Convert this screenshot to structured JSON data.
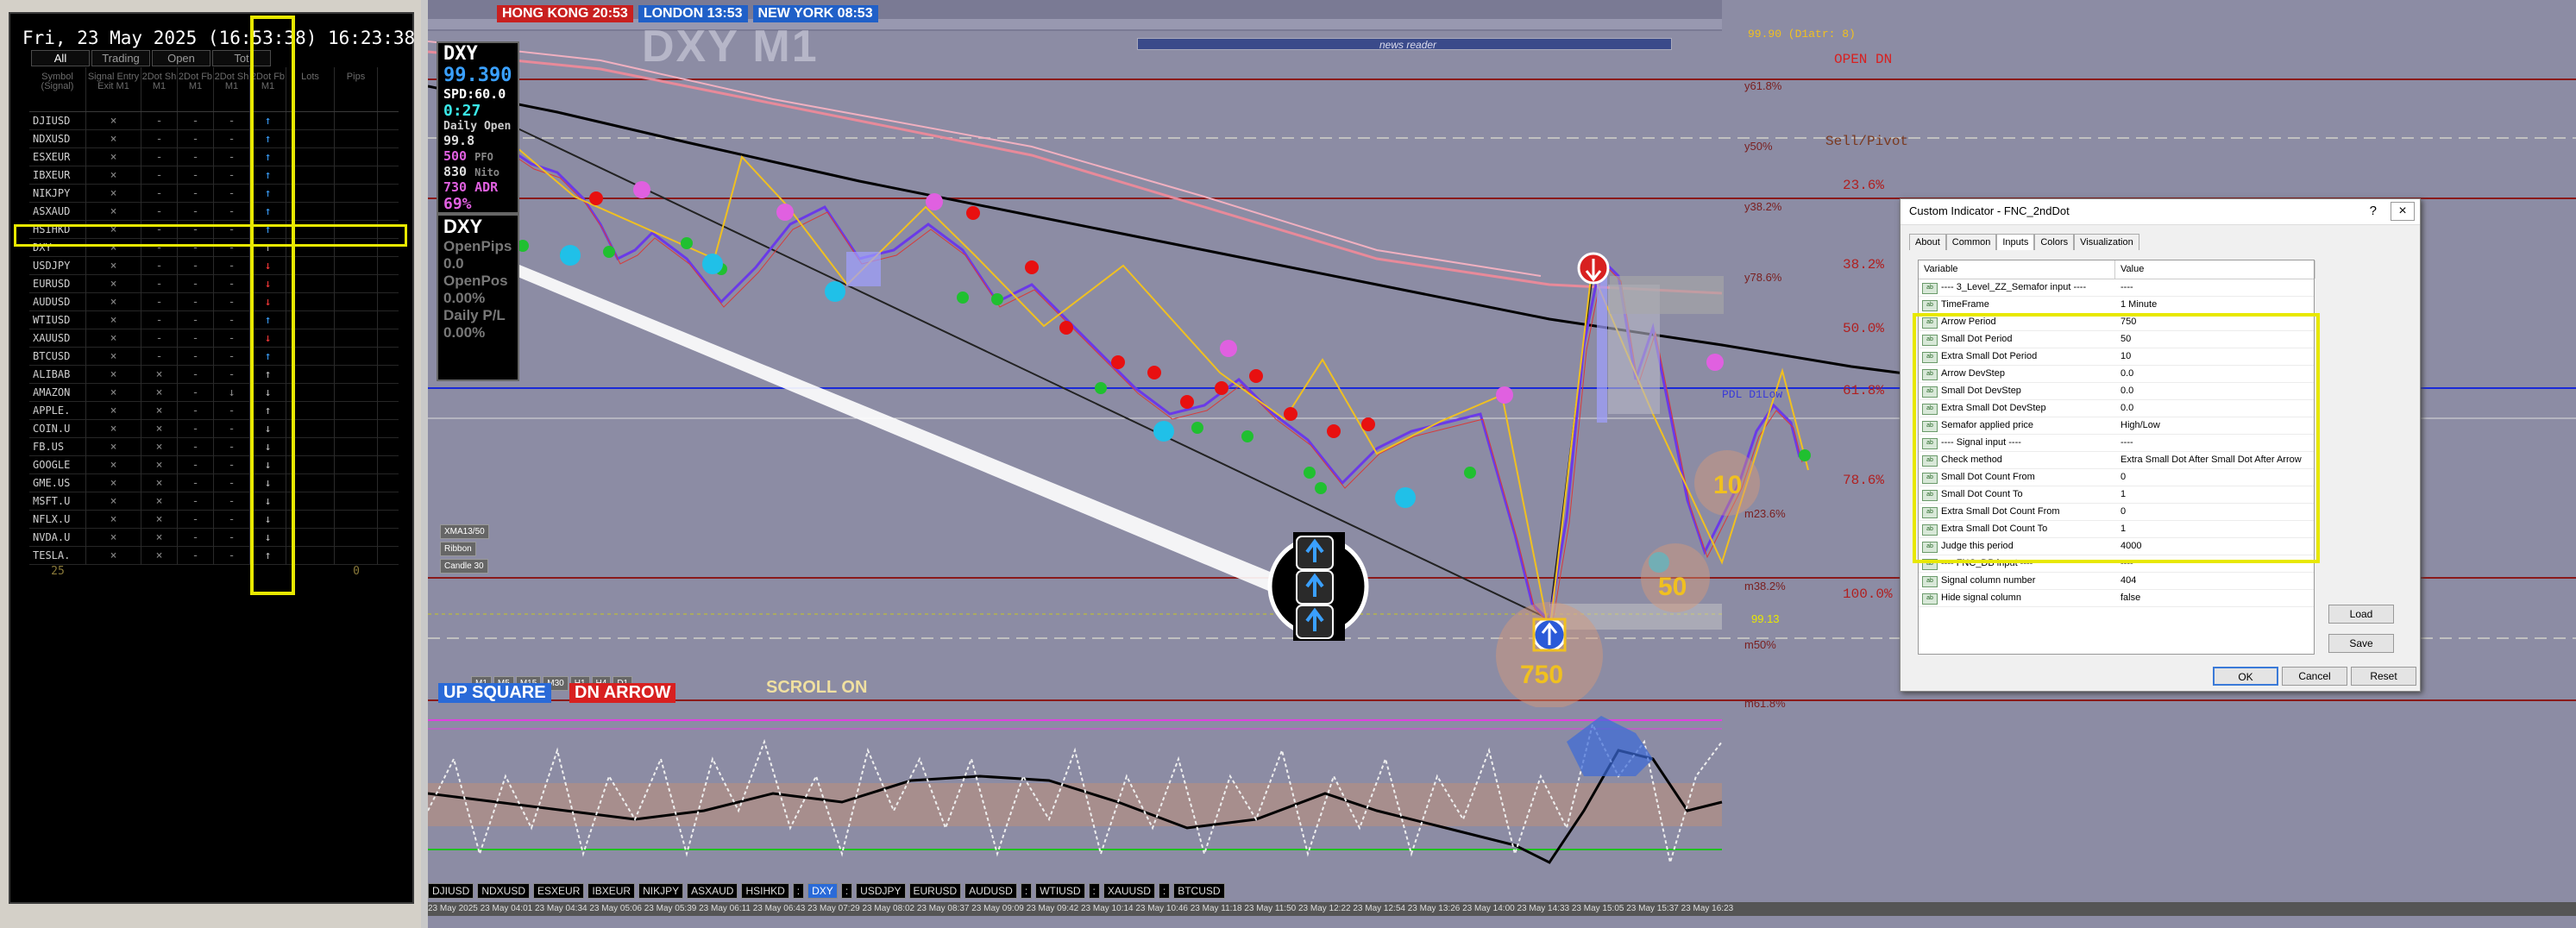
{
  "dashboard": {
    "clock": "Fri, 23 May 2025 (16:53:38) 16:23:38",
    "tabs": [
      "All",
      "Trading",
      "Open",
      "Tot"
    ],
    "headers": [
      "Symbol (Signal)",
      "Signal Entry Exit M1",
      "2Dot Sh M1",
      "2Dot Fb M1",
      "2Dot Sh M1",
      "2Dot Fb M1",
      "Lots",
      "Pips"
    ],
    "rows": [
      {
        "sym": "DJIUSD",
        "c": [
          "×",
          "-",
          "-",
          "-"
        ],
        "arrow": "↑",
        "dir": "up"
      },
      {
        "sym": "NDXUSD",
        "c": [
          "×",
          "-",
          "-",
          "-"
        ],
        "arrow": "↑",
        "dir": "up"
      },
      {
        "sym": "ESXEUR",
        "c": [
          "×",
          "-",
          "-",
          "-"
        ],
        "arrow": "↑",
        "dir": "up"
      },
      {
        "sym": "IBXEUR",
        "c": [
          "×",
          "-",
          "-",
          "-"
        ],
        "arrow": "↑",
        "dir": "up"
      },
      {
        "sym": "NIKJPY",
        "c": [
          "×",
          "-",
          "-",
          "-"
        ],
        "arrow": "↑",
        "dir": "up"
      },
      {
        "sym": "ASXAUD",
        "c": [
          "×",
          "-",
          "-",
          "-"
        ],
        "arrow": "↑",
        "dir": "up"
      },
      {
        "sym": "HSIHKD",
        "c": [
          "×",
          "-",
          "-",
          "-"
        ],
        "arrow": "↑",
        "dir": "up"
      },
      {
        "sym": "DXY",
        "c": [
          "×",
          "-",
          "-",
          "-"
        ],
        "arrow": "↑",
        "dir": "gr"
      },
      {
        "sym": "USDJPY",
        "c": [
          "×",
          "-",
          "-",
          "-"
        ],
        "arrow": "↓",
        "dir": "dn"
      },
      {
        "sym": "EURUSD",
        "c": [
          "×",
          "-",
          "-",
          "-"
        ],
        "arrow": "↓",
        "dir": "dn"
      },
      {
        "sym": "AUDUSD",
        "c": [
          "×",
          "-",
          "-",
          "-"
        ],
        "arrow": "↓",
        "dir": "dn"
      },
      {
        "sym": "WTIUSD",
        "c": [
          "×",
          "-",
          "-",
          "-"
        ],
        "arrow": "↑",
        "dir": "up"
      },
      {
        "sym": "XAUUSD",
        "c": [
          "×",
          "-",
          "-",
          "-"
        ],
        "arrow": "↓",
        "dir": "dn"
      },
      {
        "sym": "BTCUSD",
        "c": [
          "×",
          "-",
          "-",
          "-"
        ],
        "arrow": "↑",
        "dir": "up"
      },
      {
        "sym": "ALIBAB",
        "c": [
          "×",
          "×",
          "-",
          "-"
        ],
        "arrow": "↑",
        "dir": "gr"
      },
      {
        "sym": "AMAZON",
        "c": [
          "×",
          "×",
          "-",
          "↓"
        ],
        "arrow": "↓",
        "dir": "gr"
      },
      {
        "sym": "APPLE.",
        "c": [
          "×",
          "×",
          "-",
          "-"
        ],
        "arrow": "↑",
        "dir": "gr"
      },
      {
        "sym": "COIN.U",
        "c": [
          "×",
          "×",
          "-",
          "-"
        ],
        "arrow": "↓",
        "dir": "gr"
      },
      {
        "sym": "FB.US",
        "c": [
          "×",
          "×",
          "-",
          "-"
        ],
        "arrow": "↓",
        "dir": "gr"
      },
      {
        "sym": "GOOGLE",
        "c": [
          "×",
          "×",
          "-",
          "-"
        ],
        "arrow": "↓",
        "dir": "gr"
      },
      {
        "sym": "GME.US",
        "c": [
          "×",
          "×",
          "-",
          "-"
        ],
        "arrow": "↓",
        "dir": "gr"
      },
      {
        "sym": "MSFT.U",
        "c": [
          "×",
          "×",
          "-",
          "-"
        ],
        "arrow": "↓",
        "dir": "gr"
      },
      {
        "sym": "NFLX.U",
        "c": [
          "×",
          "×",
          "-",
          "-"
        ],
        "arrow": "↓",
        "dir": "gr"
      },
      {
        "sym": "NVDA.U",
        "c": [
          "×",
          "×",
          "-",
          "-"
        ],
        "arrow": "↓",
        "dir": "gr"
      },
      {
        "sym": "TESLA.",
        "c": [
          "×",
          "×",
          "-",
          "-"
        ],
        "arrow": "↑",
        "dir": "gr"
      }
    ],
    "footer_count": "25",
    "footer_pips": "0"
  },
  "chart": {
    "sessions": [
      {
        "label": "HONG KONG 20:53",
        "color": "#c82020"
      },
      {
        "label": "LONDON 13:53",
        "color": "#2060c8"
      },
      {
        "label": "NEW YORK 08:53",
        "color": "#2060c8"
      }
    ],
    "big_title": "DXY M1",
    "news": "news reader",
    "info": {
      "sym": "DXY",
      "price": "99.390",
      "spd": "SPD:60.0",
      "timer": "0:27",
      "daily_open": "Daily Open",
      "open_val": "99.8",
      "r1": "500",
      "r1b": "PFO",
      "r2": "830",
      "r2b": "Nito",
      "r3": "730",
      "r3b": "ADR",
      "pct": "69%"
    },
    "info2": {
      "sym": "DXY",
      "l1": "OpenPips",
      "l2": "0.0",
      "l3": "OpenPos",
      "l4": "0.00%",
      "l5": "Daily P/L",
      "l6": "0.00%"
    },
    "levels": {
      "d1": "99.90 (D1atr: 8)",
      "open_dn": "OPEN DN",
      "sell": "Sell/Pivot",
      "f236": "23.6%",
      "f382": "38.2%",
      "f50": "50.0%",
      "f618": "61.8%",
      "f786": "78.6%",
      "f100": "100.0%",
      "pdl": "PDL D1Low",
      "y50": "y50%",
      "y382": "y38.2%",
      "y618": "y61.8%",
      "y786": "y78.6%",
      "m382": "m38.2%",
      "m50": "m50%",
      "m618": "m61.8%",
      "m236": "m23.6%",
      "p9913": "99.13"
    },
    "circles": {
      "c750": "750",
      "c50": "50",
      "c10": "10"
    },
    "up_square": "UP SQUARE",
    "dn_arrow": "DN ARROW",
    "scroll": "SCROLL ON",
    "small_btns": [
      "XMA13/50",
      "Ribbon",
      "Candle 30"
    ],
    "tf": [
      "M1",
      "M5",
      "M15",
      "M30",
      "H1",
      "H4",
      "D1"
    ],
    "symbar": [
      "DJIUSD",
      "NDXUSD",
      "ESXEUR",
      "IBXEUR",
      "NIKJPY",
      "ASXAUD",
      "HSIHKD",
      ":",
      "DXY",
      ":",
      "USDJPY",
      "EURUSD",
      "AUDUSD",
      ":",
      "WTIUSD",
      ":",
      "XAUUSD",
      ":",
      "BTCUSD"
    ],
    "times": "23 May 2025   23 May 04:01   23 May 04:34   23 May 05:06   23 May 05:39   23 May 06:11   23 May 06:43   23 May 07:29   23 May 08:02   23 May 08:37   23 May 09:09   23 May 09:42   23 May 10:14   23 May 10:46   23 May 11:18   23 May 11:50   23 May 12:22   23 May 12:54   23 May 13:26   23 May 14:00   23 May 14:33   23 May 15:05   23 May 15:37   23 May 16:23"
  },
  "dialog": {
    "title": "Custom Indicator - FNC_2ndDot",
    "tabs": [
      "About",
      "Common",
      "Inputs",
      "Colors",
      "Visualization"
    ],
    "col_var": "Variable",
    "col_val": "Value",
    "params": [
      [
        "---- 3_Level_ZZ_Semafor input ----",
        "----"
      ],
      [
        "TimeFrame",
        "1 Minute"
      ],
      [
        "Arrow Period",
        "750"
      ],
      [
        "Small Dot Period",
        "50"
      ],
      [
        "Extra Small Dot Period",
        "10"
      ],
      [
        "Arrow DevStep",
        "0.0"
      ],
      [
        "Small Dot DevStep",
        "0.0"
      ],
      [
        "Extra Small Dot DevStep",
        "0.0"
      ],
      [
        "Semafor applied price",
        "High/Low"
      ],
      [
        "---- Signal input ----",
        "----"
      ],
      [
        "Check method",
        "Extra Small Dot After Small Dot After Arrow"
      ],
      [
        "Small Dot Count From",
        "0"
      ],
      [
        "Small Dot Count To",
        "1"
      ],
      [
        "Extra Small Dot Count From",
        "0"
      ],
      [
        "Extra Small Dot Count To",
        "1"
      ],
      [
        "Judge this period",
        "4000"
      ],
      [
        "---- FNC_DB input ----",
        "----"
      ],
      [
        "Signal column number",
        "404"
      ],
      [
        "Hide signal column",
        "false"
      ]
    ],
    "load": "Load",
    "save": "Save",
    "ok": "OK",
    "cancel": "Cancel",
    "reset": "Reset"
  }
}
